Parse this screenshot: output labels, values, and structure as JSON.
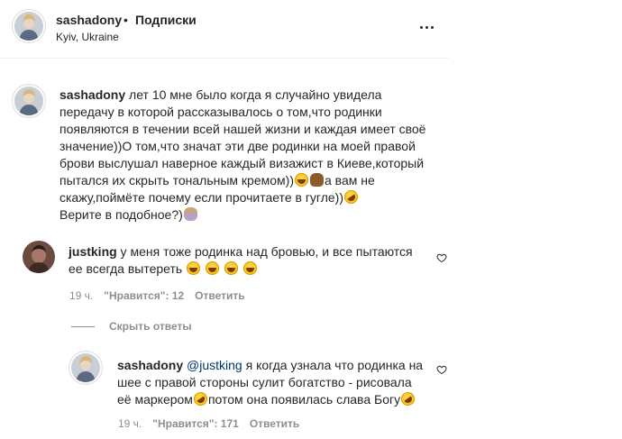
{
  "header": {
    "username": "sashadony",
    "separator": "•",
    "follow_label": "Подписки",
    "location": "Kyiv, Ukraine"
  },
  "caption": {
    "username": "sashadony",
    "text": " лет 10 мне было когда я случайно увидела передачу в которой рассказывалось о том,что родинки появляются в течении всей нашей жизни и каждая имеет своё значение))О том,что значат эти две родинки на моей правой брови выслушал наверное каждый визажист в Киеве,который пытался их скрыть тональным кремом))",
    "text2": "а вам не скажу,поймёте почему если прочитаете в гугле))",
    "text3": "Верите в подобное?)"
  },
  "comments": [
    {
      "username": "justking",
      "text": " у меня тоже родинка над бровью, и все пытаются ее всегда вытереть ",
      "time": "19 ч.",
      "likes": "\"Нравится\": 12",
      "reply_label": "Ответить"
    }
  ],
  "hide_replies_label": "Скрыть ответы",
  "replies": [
    {
      "username": "sashadony",
      "mention": "@justking",
      "text": " я когда узнала что родинка на шее с правой стороны сулит богатство - рисовала её маркером",
      "text2": "потом она появилась слава Богу",
      "time": "19 ч.",
      "likes": "\"Нравится\": 171",
      "reply_label": "Ответить"
    }
  ],
  "icons": {
    "more": "more-options-icon",
    "heart": "heart-icon",
    "emoji_laugh": "grinning-sweat-emoji",
    "emoji_rofl": "rofl-emoji",
    "emoji_hand": "raised-hand-emoji",
    "emoji_woman": "woman-shrugging-emoji"
  },
  "colors": {
    "text": "#262626",
    "secondary": "#8e8e8e",
    "mention": "#00376b",
    "divider": "#efefef"
  }
}
